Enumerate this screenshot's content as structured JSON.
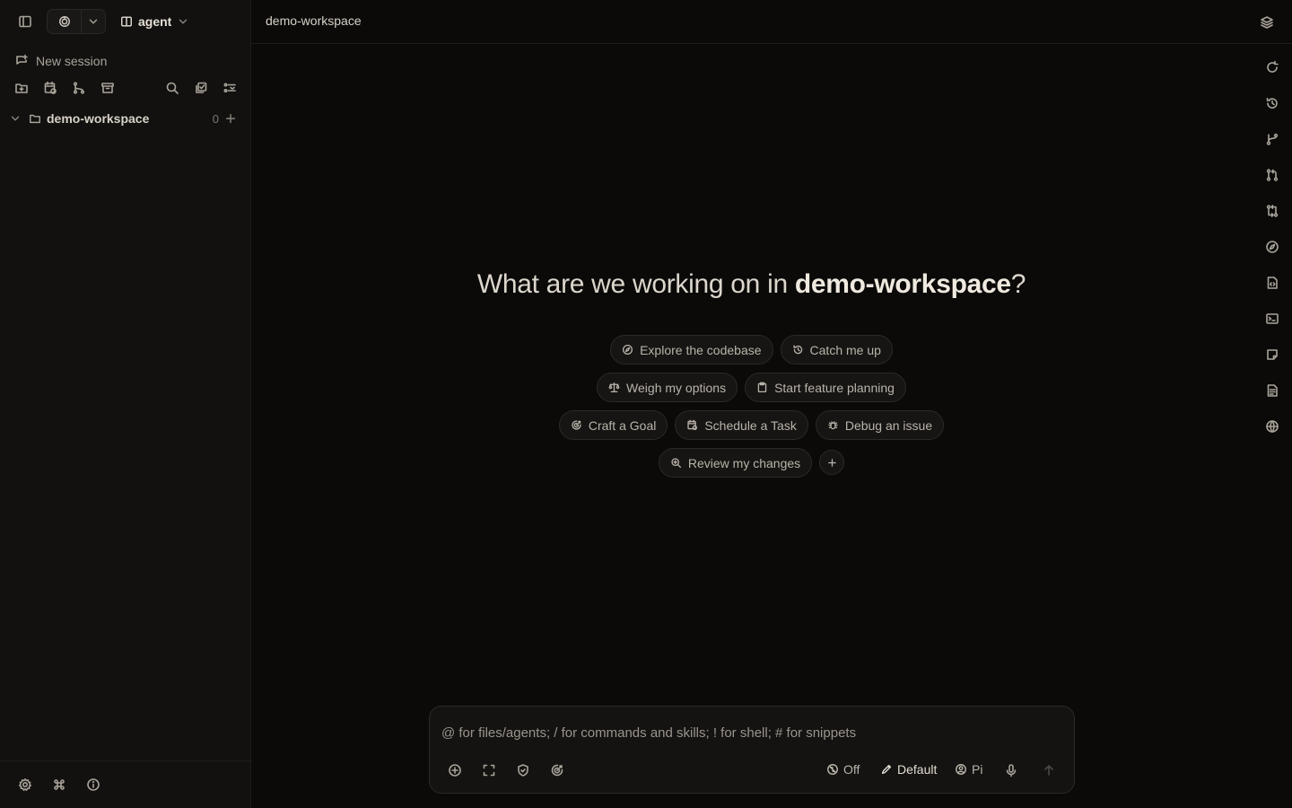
{
  "sidebar": {
    "agent_label": "agent",
    "new_session_label": "New session",
    "workspace": {
      "name": "demo-workspace",
      "count": "0"
    }
  },
  "header": {
    "title": "demo-workspace"
  },
  "hero": {
    "prefix": "What are we working on in ",
    "workspace": "demo-workspace",
    "suffix": "?"
  },
  "suggestions": [
    [
      "Explore the codebase",
      "Catch me up"
    ],
    [
      "Weigh my options",
      "Start feature planning"
    ],
    [
      "Craft a Goal",
      "Schedule a Task",
      "Debug an issue"
    ],
    [
      "Review my changes"
    ]
  ],
  "composer": {
    "placeholder": "@ for files/agents; / for commands and skills; ! for shell; # for snippets",
    "thinking": "Off",
    "mode": "Default",
    "model": "Pi"
  },
  "icons": {
    "right_rail": [
      "refresh-icon",
      "history-icon",
      "git-branch-icon",
      "pull-request-icon",
      "git-compare-icon",
      "compass-icon",
      "code-file-icon",
      "terminal-icon",
      "sticky-note-icon",
      "document-icon",
      "globe-icon"
    ]
  }
}
